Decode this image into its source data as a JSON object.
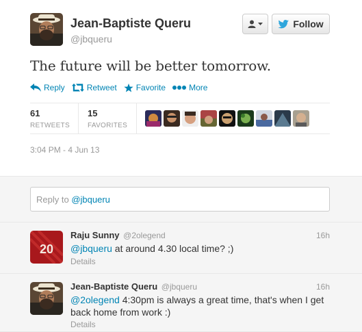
{
  "tweet": {
    "fullname": "Jean-Baptiste Queru",
    "username": "@jbqueru",
    "follow_label": "Follow",
    "text": "The future will be better tomorrow.",
    "actions": {
      "reply": "Reply",
      "retweet": "Retweet",
      "favorite": "Favorite",
      "more": "More"
    },
    "stats": {
      "retweets_count": "61",
      "retweets_label": "RETWEETS",
      "favorites_count": "15",
      "favorites_label": "FAVORITES"
    },
    "timestamp": "3:04 PM - 4 Jun 13"
  },
  "reply_box": {
    "prefix": "Reply to ",
    "mention": "@jbqueru"
  },
  "replies": [
    {
      "fullname": "Raju Sunny",
      "username": "@2olegend",
      "time": "16h",
      "mention": "@jbqueru",
      "text": " at around 4.30 local time? ;)",
      "details": "Details",
      "avatar_text": "20"
    },
    {
      "fullname": "Jean-Baptiste Queru",
      "username": "@jbqueru",
      "time": "16h",
      "mention": "@2olegend",
      "text": " 4:30pm is always a great time, that's when I get back home from work :)",
      "details": "Details"
    }
  ],
  "colors": {
    "link": "#0084b4",
    "muted": "#999999",
    "text": "#333333",
    "follow_bird": "#2fa6dc"
  }
}
